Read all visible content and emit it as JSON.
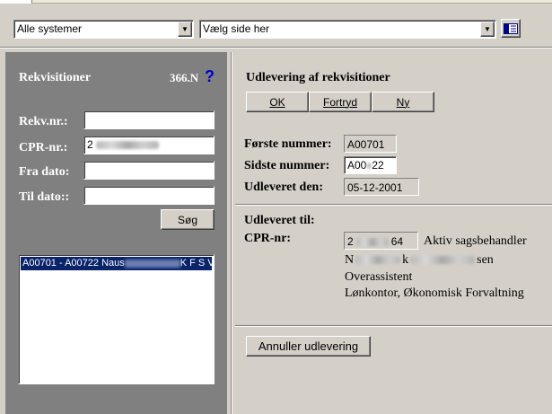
{
  "topbar": {
    "system_select": "Alle systemer",
    "page_select": "Vælg side her"
  },
  "left": {
    "title": "Rekvisitioner",
    "code": "366.N",
    "help": "?",
    "fields": {
      "rekv_label": "Rekv.nr.:",
      "rekv_value": "",
      "cpr_label": "CPR-nr.:",
      "cpr_value": "2",
      "fra_label": "Fra dato:",
      "fra_value": "",
      "til_label": "Til dato::",
      "til_value": ""
    },
    "search_button": "Søg",
    "list_item_prefix": "A00701 - A00722 Naus",
    "list_item_suffix": "K F S Vans"
  },
  "right": {
    "title": "Udlevering af rekvisitioner",
    "buttons": {
      "ok": "OK",
      "fortryd": "Fortryd",
      "ny": "Ny"
    },
    "forste_label": "Første nummer:",
    "forste_value": "A00701",
    "sidste_label": "Sidste nummer:",
    "sidste_value_a": "A00",
    "sidste_value_b": "22",
    "udleveret_label": "Udleveret den:",
    "udleveret_value": "05-12-2001",
    "til_header": "Udleveret til:",
    "cpr_label": "CPR-nr:",
    "cpr_value_a": "2",
    "cpr_value_b": "64",
    "role": "Aktiv sagsbehandler",
    "name_a": "N",
    "name_b": "k",
    "name_c": "sen",
    "title_line": "Overassistent",
    "dept_line": "Lønkontor, Økonomisk Forvaltning",
    "cancel_button": "Annuller udlevering"
  },
  "colors": {
    "left_panel": "#808080",
    "background": "#d4d0c8",
    "selection": "#0a246a"
  }
}
